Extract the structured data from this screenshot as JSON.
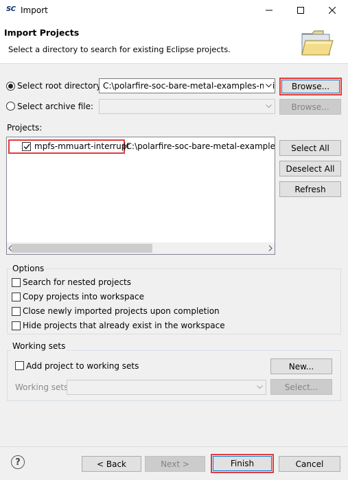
{
  "window": {
    "app_logo": "SC",
    "title": "Import"
  },
  "header": {
    "title": "Import Projects",
    "description": "Select a directory to search for existing Eclipse projects."
  },
  "source": {
    "root_dir_label": "Select root directory:",
    "root_dir_value": "C:\\polarfire-soc-bare-metal-examples-main",
    "archive_label": "Select archive file:",
    "archive_value": "",
    "browse_label": "Browse...",
    "browse_archive_label": "Browse..."
  },
  "projects": {
    "label": "Projects:",
    "items": [
      {
        "name": "mpfs-mmuart-interrupt",
        "path": "(C:\\polarfire-soc-bare-metal-examples-main",
        "checked": true
      }
    ],
    "select_all": "Select All",
    "deselect_all": "Deselect All",
    "refresh": "Refresh"
  },
  "options": {
    "title": "Options",
    "items": [
      {
        "label": "Search for nested projects",
        "checked": false
      },
      {
        "label": "Copy projects into workspace",
        "checked": false
      },
      {
        "label": "Close newly imported projects upon completion",
        "checked": false
      },
      {
        "label": "Hide projects that already exist in the workspace",
        "checked": false
      }
    ]
  },
  "working_sets": {
    "title": "Working sets",
    "add_label": "Add project to working sets",
    "new_button": "New...",
    "sets_label": "Working sets:",
    "sets_value": "",
    "select_button": "Select..."
  },
  "footer": {
    "help": "?",
    "back": "< Back",
    "next": "Next >",
    "finish": "Finish",
    "cancel": "Cancel"
  },
  "colors": {
    "highlight": "#e03c3c",
    "focus": "#0078d7"
  }
}
